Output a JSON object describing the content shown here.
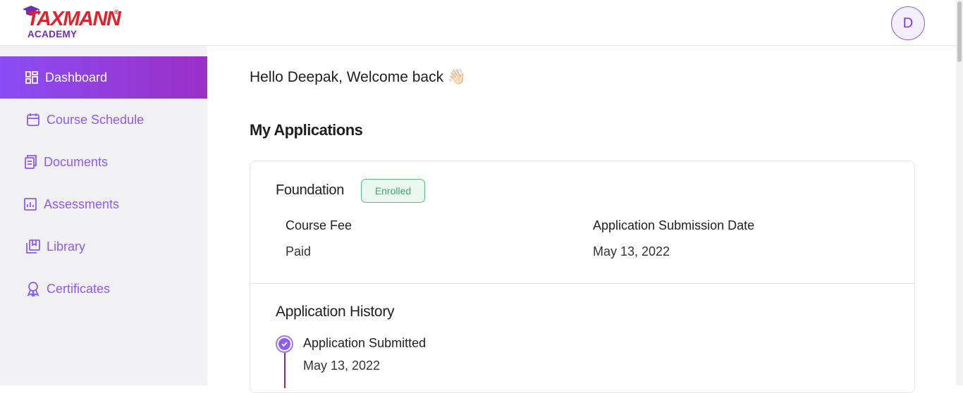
{
  "header": {
    "logo_main": "TAXMANN",
    "logo_registered": "®",
    "logo_sub": "ACADEMY",
    "avatar_initial": "D"
  },
  "sidebar": {
    "items": [
      {
        "label": "Dashboard",
        "icon": "dashboard-icon",
        "active": true
      },
      {
        "label": "Course Schedule",
        "icon": "calendar-icon",
        "active": false
      },
      {
        "label": "Documents",
        "icon": "documents-icon",
        "active": false
      },
      {
        "label": "Assessments",
        "icon": "bar-chart-icon",
        "active": false
      },
      {
        "label": "Library",
        "icon": "library-icon",
        "active": false
      },
      {
        "label": "Certificates",
        "icon": "award-icon",
        "active": false
      }
    ]
  },
  "main": {
    "greeting": "Hello Deepak, Welcome back 👋🏻",
    "section_title": "My Applications",
    "application": {
      "course_name": "Foundation",
      "status": "Enrolled",
      "fee_label": "Course Fee",
      "fee_value": "Paid",
      "date_label": "Application Submission Date",
      "date_value": "May 13, 2022",
      "history_title": "Application History",
      "history": [
        {
          "title": "Application Submitted",
          "date": "May 13, 2022"
        }
      ]
    }
  },
  "colors": {
    "accent": "#8b5cf6",
    "active_gradient_start": "#8a4df3",
    "active_gradient_end": "#9b2fc7",
    "brand_red": "#e3202b",
    "brand_purple": "#6b2fb8",
    "enrolled_green": "#3cab6a"
  }
}
